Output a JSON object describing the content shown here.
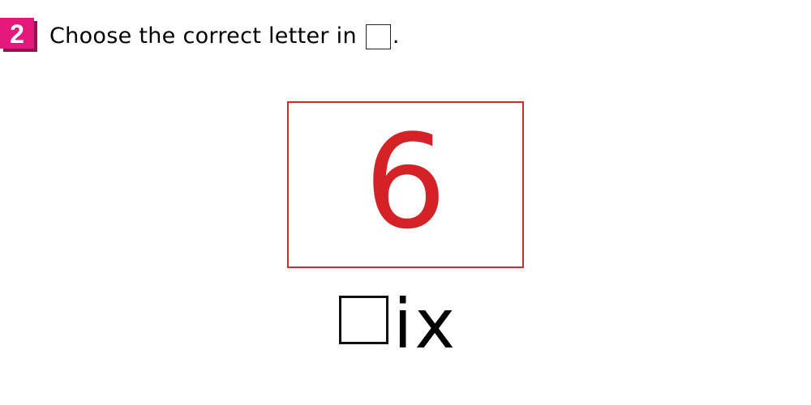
{
  "question": {
    "number": "2",
    "badge_color": "#e5197b",
    "instruction_text": "Choose the correct letter in",
    "instruction_end": "."
  },
  "card": {
    "numeral": "6",
    "border_color": "#d42a2a",
    "numeral_color": "#d42226"
  },
  "word": {
    "missing_letter_box": "",
    "rest": "ix"
  }
}
